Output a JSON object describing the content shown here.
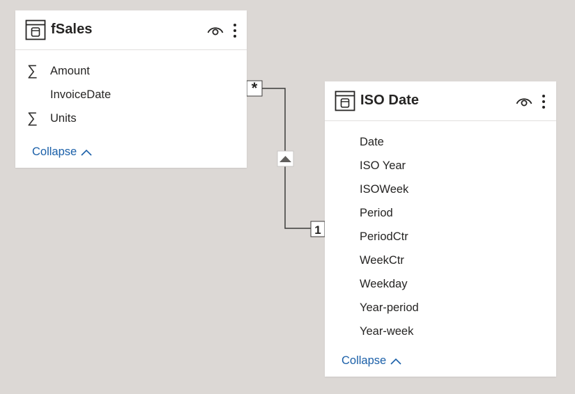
{
  "relationship": {
    "from_cardinality": "*",
    "to_cardinality": "1",
    "filter_direction_icon": "triangle-up-icon"
  },
  "tables": [
    {
      "name": "fSales",
      "icon": "table-icon",
      "header_icons": [
        "eye-icon",
        "more-icon"
      ],
      "fields": [
        {
          "label": "Amount",
          "aggregate": true,
          "aggregate_symbol": "∑"
        },
        {
          "label": "InvoiceDate",
          "aggregate": false
        },
        {
          "label": "Units",
          "aggregate": true,
          "aggregate_symbol": "∑"
        }
      ],
      "collapse_label": "Collapse"
    },
    {
      "name": "ISO Date",
      "icon": "table-icon",
      "header_icons": [
        "eye-icon",
        "more-icon"
      ],
      "fields": [
        {
          "label": "Date",
          "aggregate": false
        },
        {
          "label": "ISO Year",
          "aggregate": false
        },
        {
          "label": "ISOWeek",
          "aggregate": false
        },
        {
          "label": "Period",
          "aggregate": false
        },
        {
          "label": "PeriodCtr",
          "aggregate": false
        },
        {
          "label": "WeekCtr",
          "aggregate": false
        },
        {
          "label": "Weekday",
          "aggregate": false
        },
        {
          "label": "Year-period",
          "aggregate": false
        },
        {
          "label": "Year-week",
          "aggregate": false
        }
      ],
      "collapse_label": "Collapse"
    }
  ],
  "colors": {
    "canvas": "#dcd8d5",
    "card": "#ffffff",
    "link": "#1a5fa8",
    "connector": "#444444"
  }
}
